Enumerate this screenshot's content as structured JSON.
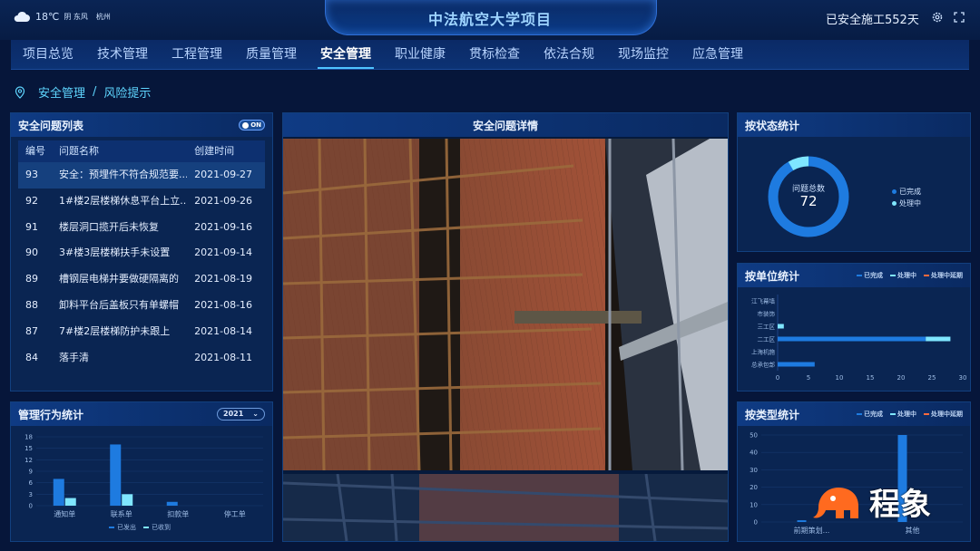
{
  "header": {
    "title": "中法航空大学项目",
    "weather_temp": "18℃",
    "weather_desc": "阴 东风",
    "city": "杭州",
    "safe_days": "已安全施工552天"
  },
  "nav": {
    "items": [
      "项目总览",
      "技术管理",
      "工程管理",
      "质量管理",
      "安全管理",
      "职业健康",
      "贯标检查",
      "依法合规",
      "现场监控",
      "应急管理"
    ],
    "active_index": 4
  },
  "breadcrumb": {
    "parent": "安全管理",
    "sep": "/",
    "current": "风险提示"
  },
  "issue_list": {
    "title": "安全问题列表",
    "toggle_label": "ON",
    "columns": [
      "编号",
      "问题名称",
      "创建时间"
    ],
    "rows": [
      {
        "id": "93",
        "name": "安全：预埋件不符合规范要...",
        "date": "2021-09-27"
      },
      {
        "id": "92",
        "name": "1#楼2层楼梯休息平台上立...",
        "date": "2021-09-26"
      },
      {
        "id": "91",
        "name": "楼层洞口揽开后未恢复",
        "date": "2021-09-16"
      },
      {
        "id": "90",
        "name": "3#楼3层楼梯扶手未设置",
        "date": "2021-09-14"
      },
      {
        "id": "89",
        "name": "槽钢层电梯井要做硬隔离的",
        "date": "2021-08-19"
      },
      {
        "id": "88",
        "name": "卸料平台后盖板只有单螺帽",
        "date": "2021-08-16"
      },
      {
        "id": "87",
        "name": "7#楼2层楼梯防护未跟上",
        "date": "2021-08-14"
      },
      {
        "id": "84",
        "name": "落手清",
        "date": "2021-08-11"
      }
    ],
    "selected_index": 0
  },
  "detail": {
    "title": "安全问题详情"
  },
  "status_stats": {
    "title": "按状态统计",
    "center_label": "问题总数",
    "total": "72",
    "legend": [
      "已完成",
      "处理中"
    ],
    "done": 66,
    "processing": 6,
    "colors": {
      "done": "#1e7be0",
      "processing": "#7fe6ff"
    }
  },
  "behavior_stats": {
    "title": "管理行为统计",
    "year": "2021",
    "chart_data": {
      "type": "bar",
      "categories": [
        "通知单",
        "联系单",
        "扣款单",
        "停工单"
      ],
      "series": [
        {
          "name": "已发出",
          "values": [
            7,
            16,
            1,
            0
          ],
          "color": "#1e7be0"
        },
        {
          "name": "已收到",
          "values": [
            2,
            3,
            0,
            0
          ],
          "color": "#7fe6ff"
        }
      ],
      "yticks": [
        "18",
        "15",
        "12",
        "9",
        "6",
        "3",
        "0"
      ],
      "ylim": [
        0,
        18
      ]
    }
  },
  "unit_stats": {
    "title": "按单位统计",
    "legend": [
      "已完成",
      "处理中",
      "处理中延期"
    ],
    "legend_colors": [
      "#1e7be0",
      "#7fe6ff",
      "#ff6a3d"
    ],
    "chart_data": {
      "type": "bar",
      "orientation": "horizontal",
      "categories": [
        "江飞幕墙",
        "市装饰",
        "三工区",
        "二工区",
        "上海机施",
        "总承包部"
      ],
      "series": [
        {
          "name": "已完成",
          "values": [
            0,
            0,
            0,
            24,
            0,
            6
          ],
          "color": "#1e7be0"
        },
        {
          "name": "处理中",
          "values": [
            0,
            0,
            1,
            4,
            0,
            0
          ],
          "color": "#7fe6ff"
        },
        {
          "name": "处理中延期",
          "values": [
            0,
            0,
            0,
            0,
            0,
            0
          ],
          "color": "#ff6a3d"
        }
      ],
      "xticks": [
        "0",
        "5",
        "10",
        "15",
        "20",
        "25",
        "30"
      ],
      "xlim": [
        0,
        30
      ]
    }
  },
  "type_stats": {
    "title": "按类型统计",
    "legend": [
      "已完成",
      "处理中",
      "处理中延期"
    ],
    "legend_colors": [
      "#1e7be0",
      "#7fe6ff",
      "#ff6a3d"
    ],
    "chart_data": {
      "type": "bar",
      "categories": [
        "前期策划...",
        "其他"
      ],
      "series": [
        {
          "name": "已完成",
          "values": [
            1,
            50
          ],
          "color": "#1e7be0"
        },
        {
          "name": "处理中",
          "values": [
            0,
            0
          ],
          "color": "#7fe6ff"
        },
        {
          "name": "处理中延期",
          "values": [
            0,
            0
          ],
          "color": "#ff6a3d"
        }
      ],
      "yticks": [
        "50",
        "40",
        "30",
        "20",
        "10",
        "0"
      ],
      "ylim": [
        0,
        50
      ]
    }
  },
  "logo": {
    "text": "程象"
  }
}
